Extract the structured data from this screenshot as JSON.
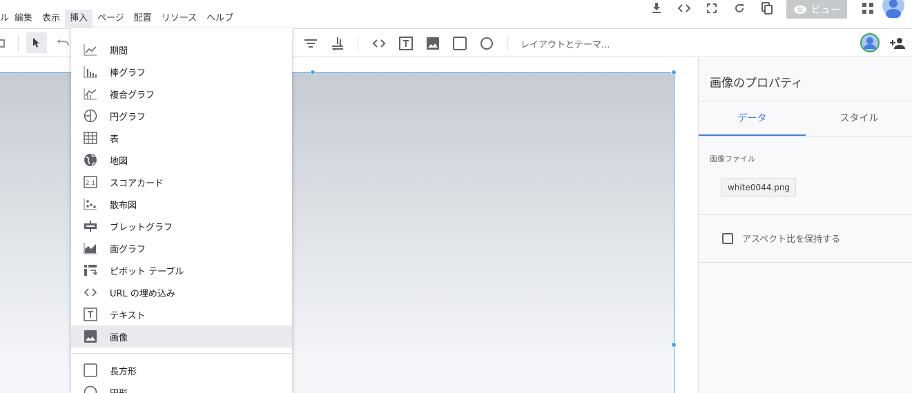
{
  "menu": {
    "items": [
      {
        "label": "ル"
      },
      {
        "label": "編集"
      },
      {
        "label": "表示"
      },
      {
        "label": "挿入"
      },
      {
        "label": "ページ"
      },
      {
        "label": "配置"
      },
      {
        "label": "リソース"
      },
      {
        "label": "ヘルプ"
      }
    ]
  },
  "topright": {
    "view_label": "ビュー"
  },
  "toolbar": {
    "theme_label": "レイアウトとテーマ..."
  },
  "dropdown": {
    "items": [
      {
        "label": "期間",
        "icon": "timeseries-icon"
      },
      {
        "label": "棒グラフ",
        "icon": "bar-chart-icon"
      },
      {
        "label": "複合グラフ",
        "icon": "combo-chart-icon"
      },
      {
        "label": "円グラフ",
        "icon": "pie-chart-icon"
      },
      {
        "label": "表",
        "icon": "table-icon"
      },
      {
        "label": "地図",
        "icon": "globe-icon"
      },
      {
        "label": "スコアカード",
        "icon": "scorecard-icon"
      },
      {
        "label": "散布図",
        "icon": "scatter-icon"
      },
      {
        "label": "ブレットグラフ",
        "icon": "bullet-chart-icon"
      },
      {
        "label": "面グラフ",
        "icon": "area-chart-icon"
      },
      {
        "label": "ピボット テーブル",
        "icon": "pivot-table-icon"
      },
      {
        "label": "URL の埋め込み",
        "icon": "embed-icon"
      },
      {
        "label": "テキスト",
        "icon": "text-icon"
      },
      {
        "label": "画像",
        "icon": "image-icon"
      },
      {
        "label": "長方形",
        "icon": "rectangle-icon"
      },
      {
        "label": "円形",
        "icon": "circle-icon"
      }
    ]
  },
  "panel": {
    "title": "画像のプロパティ",
    "tabs": [
      {
        "label": "データ"
      },
      {
        "label": "スタイル"
      }
    ],
    "section_label": "画像ファイル",
    "file_name": "white0044.png",
    "checkbox_label": "アスペクト比を保持する"
  },
  "colors": {
    "accent": "#4a7be0",
    "selection": "#4aa3e8"
  }
}
